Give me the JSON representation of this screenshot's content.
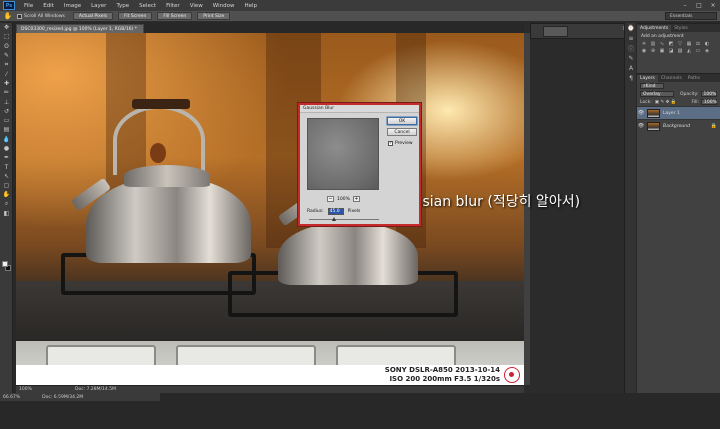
{
  "app": {
    "logo": "Ps"
  },
  "menu": [
    "File",
    "Edit",
    "Image",
    "Layer",
    "Type",
    "Select",
    "Filter",
    "View",
    "Window",
    "Help"
  ],
  "window_controls": {
    "minimize": "–",
    "maximize": "□",
    "close": "×"
  },
  "options_bar": {
    "tool_icon": "hand-tool-icon",
    "scroll_all_label": "Scroll All Windows",
    "buttons": [
      "Actual Pixels",
      "Fit Screen",
      "Fill Screen",
      "Print Size"
    ],
    "workspace": "Essentials"
  },
  "document": {
    "tab_title": "DSC03300_resized.jpg @ 100% (Layer 1, RGB/16) *",
    "zoom": "100%",
    "doc_info": "Doc: 7.28M/14.5M"
  },
  "photo": {
    "annotation": "6. gaussian blur (적당히 알아서)",
    "exif_line1": "SONY DSLR-A850 2013-10-14",
    "exif_line2": "ISO 200 200mm F3.5 1/320s"
  },
  "dialog": {
    "title": "Gaussian Blur",
    "ok": "OK",
    "cancel": "Cancel",
    "preview_label": "Preview",
    "preview_checked": true,
    "zoom_value": "100%",
    "zoom_minus": "−",
    "zoom_plus": "+",
    "radius_label": "Radius:",
    "radius_value": "45.0",
    "radius_unit": "Pixels"
  },
  "adjustments": {
    "tabs": [
      "Adjustments",
      "Styles"
    ],
    "title": "Add an adjustment"
  },
  "layers": {
    "tabs": [
      "Layers",
      "Channels",
      "Paths"
    ],
    "kind": "Kind",
    "blend_mode": "Overlay",
    "opacity_label": "Opacity:",
    "opacity_value": "100%",
    "lock_label": "Lock:",
    "fill_label": "Fill:",
    "fill_value": "100%",
    "items": [
      {
        "name": "Layer 1",
        "selected": true
      },
      {
        "name": "Background",
        "selected": false,
        "locked": true
      }
    ]
  },
  "bottom_bar": {
    "zoom": "66.67%",
    "doc_info": "Doc: 6.59M/34.2M"
  }
}
